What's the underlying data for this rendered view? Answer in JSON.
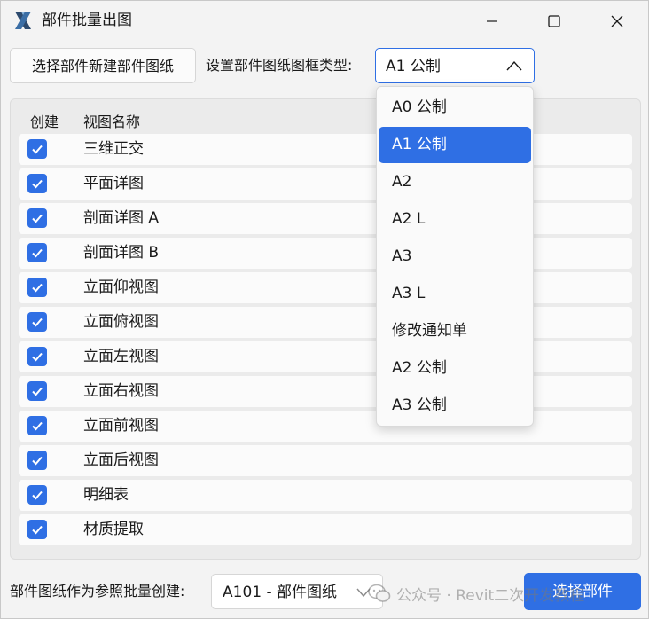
{
  "window": {
    "title": "部件批量出图",
    "controls": [
      "minimize",
      "maximize",
      "close"
    ]
  },
  "toolbar": {
    "new_sheet_button": "选择部件新建部件图纸",
    "frame_type_label": "设置部件图纸图框类型:",
    "frame_type_value": "A1 公制"
  },
  "views_table": {
    "headers": {
      "create": "创建",
      "name": "视图名称"
    },
    "rows": [
      {
        "checked": true,
        "name": "三维正交"
      },
      {
        "checked": true,
        "name": "平面详图"
      },
      {
        "checked": true,
        "name": "剖面详图 A"
      },
      {
        "checked": true,
        "name": "剖面详图 B"
      },
      {
        "checked": true,
        "name": "立面仰视图"
      },
      {
        "checked": true,
        "name": "立面俯视图"
      },
      {
        "checked": true,
        "name": "立面左视图"
      },
      {
        "checked": true,
        "name": "立面右视图"
      },
      {
        "checked": true,
        "name": "立面前视图"
      },
      {
        "checked": true,
        "name": "立面后视图"
      },
      {
        "checked": true,
        "name": "明细表"
      },
      {
        "checked": true,
        "name": "材质提取"
      }
    ]
  },
  "frame_dropdown": {
    "options": [
      "A0 公制",
      "A1 公制",
      "A2",
      "A2 L",
      "A3",
      "A3 L",
      "修改通知单",
      "A2 公制",
      "A3 公制"
    ],
    "selected": "A1 公制"
  },
  "footer": {
    "reference_label": "部件图纸作为参照批量创建:",
    "reference_value": "A101 - 部件图纸",
    "select_button": "选择部件",
    "watermark": "公众号 · Revit二次开发教程"
  },
  "colors": {
    "accent": "#2f6fe4",
    "window_bg": "#f3f3f3",
    "row_bg": "#fbfbfb"
  }
}
